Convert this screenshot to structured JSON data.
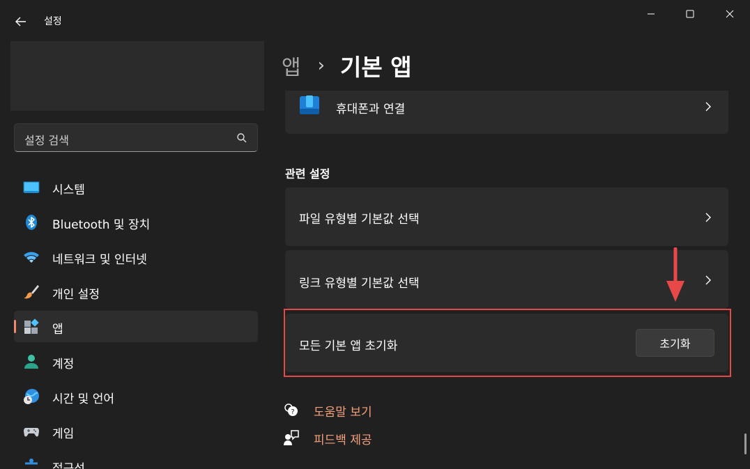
{
  "window": {
    "title": "설정"
  },
  "search": {
    "placeholder": "설정 검색"
  },
  "sidebar": {
    "items": [
      {
        "label": "시스템",
        "icon": "system-icon"
      },
      {
        "label": "Bluetooth 및 장치",
        "icon": "bluetooth-icon"
      },
      {
        "label": "네트워크 및 인터넷",
        "icon": "wifi-icon"
      },
      {
        "label": "개인 설정",
        "icon": "paintbrush-icon"
      },
      {
        "label": "앱",
        "icon": "apps-icon",
        "active": true
      },
      {
        "label": "계정",
        "icon": "account-icon"
      },
      {
        "label": "시간 및 언어",
        "icon": "globe-clock-icon"
      },
      {
        "label": "게임",
        "icon": "gamepad-icon"
      },
      {
        "label": "접근성",
        "icon": "accessibility-icon"
      }
    ]
  },
  "breadcrumb": {
    "parent": "앱",
    "separator": "›",
    "current": "기본 앱"
  },
  "main": {
    "top_item": {
      "label": "휴대폰과 연결",
      "icon": "phone-link-icon"
    },
    "related_heading": "관련 설정",
    "related_items": [
      {
        "label": "파일 유형별 기본값 선택"
      },
      {
        "label": "링크 유형별 기본값 선택"
      }
    ],
    "reset_row": {
      "label": "모든 기본 앱 초기화",
      "button_label": "초기화"
    }
  },
  "footer_links": [
    {
      "label": "도움말 보기",
      "icon": "help-icon"
    },
    {
      "label": "피드백 제공",
      "icon": "feedback-icon"
    }
  ],
  "colors": {
    "background": "#202020",
    "card": "#2b2b2b",
    "accent": "#f08a6b",
    "link": "#f3a07d",
    "highlight": "#e24a4a"
  }
}
